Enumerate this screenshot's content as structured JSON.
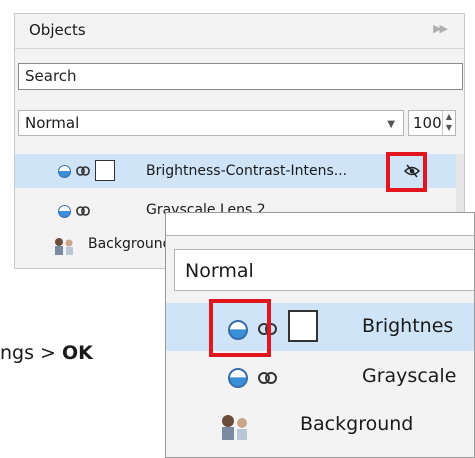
{
  "panel": {
    "title": "Objects",
    "search_placeholder": "Search",
    "blend_mode": "Normal",
    "opacity": "100"
  },
  "layers": [
    {
      "name": "Brightness-Contrast-Intens...",
      "selected": true
    },
    {
      "name": "Grayscale Lens 2",
      "selected": false
    },
    {
      "name": "Background",
      "selected": false
    }
  ],
  "zoom": {
    "blend_mode": "Normal",
    "layers": [
      {
        "name": "Brightnes"
      },
      {
        "name": "Grayscale"
      },
      {
        "name": "Background"
      }
    ]
  },
  "instruction": {
    "prefix": "ngs > ",
    "ok": "OK"
  },
  "colors": {
    "highlight_red": "#e2141e",
    "selected_row": "#cfe4f7"
  }
}
